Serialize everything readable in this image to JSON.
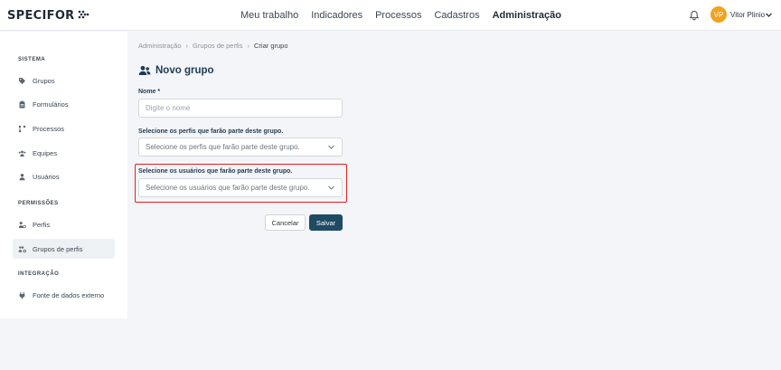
{
  "header": {
    "logo_text": "SPECIFOR",
    "nav": [
      "Meu trabalho",
      "Indicadores",
      "Processos",
      "Cadastros",
      "Administração"
    ],
    "active_nav": "Administração",
    "user_initials": "VP",
    "user_name": "Vitor Plinio",
    "avatar_color": "#f2a21e"
  },
  "sidebar": {
    "sections": [
      {
        "title": "SISTEMA",
        "items": [
          {
            "label": "Grupos",
            "icon": "tag-icon"
          },
          {
            "label": "Formulários",
            "icon": "clipboard-icon"
          },
          {
            "label": "Processos",
            "icon": "flow-icon"
          },
          {
            "label": "Equipes",
            "icon": "team-icon"
          },
          {
            "label": "Usuários",
            "icon": "user-icon"
          }
        ]
      },
      {
        "title": "PERMISSÕES",
        "items": [
          {
            "label": "Perfis",
            "icon": "user-gear-icon"
          },
          {
            "label": "Grupos de perfis",
            "icon": "users-gear-icon",
            "active": true
          }
        ]
      },
      {
        "title": "INTEGRAÇÃO",
        "items": [
          {
            "label": "Fonte de dados externo",
            "icon": "plug-icon"
          }
        ]
      }
    ]
  },
  "breadcrumb": [
    "Administração",
    "Grupos de perfis",
    "Criar grupo"
  ],
  "page_title": "Novo grupo",
  "form": {
    "name_label": "Nome *",
    "name_placeholder": "Digite o nome",
    "profiles_label": "Selecione os perfis que farão parte deste grupo.",
    "profiles_placeholder": "Selecione os perfis que farão parte deste grupo.",
    "users_label": "Selecione os usuários que farão parte deste grupo.",
    "users_placeholder": "Selecione os usuários que farão parte deste grupo.",
    "cancel_label": "Cancelar",
    "save_label": "Salvar"
  },
  "colors": {
    "primary": "#1f4a64",
    "highlight": "#e02020"
  }
}
